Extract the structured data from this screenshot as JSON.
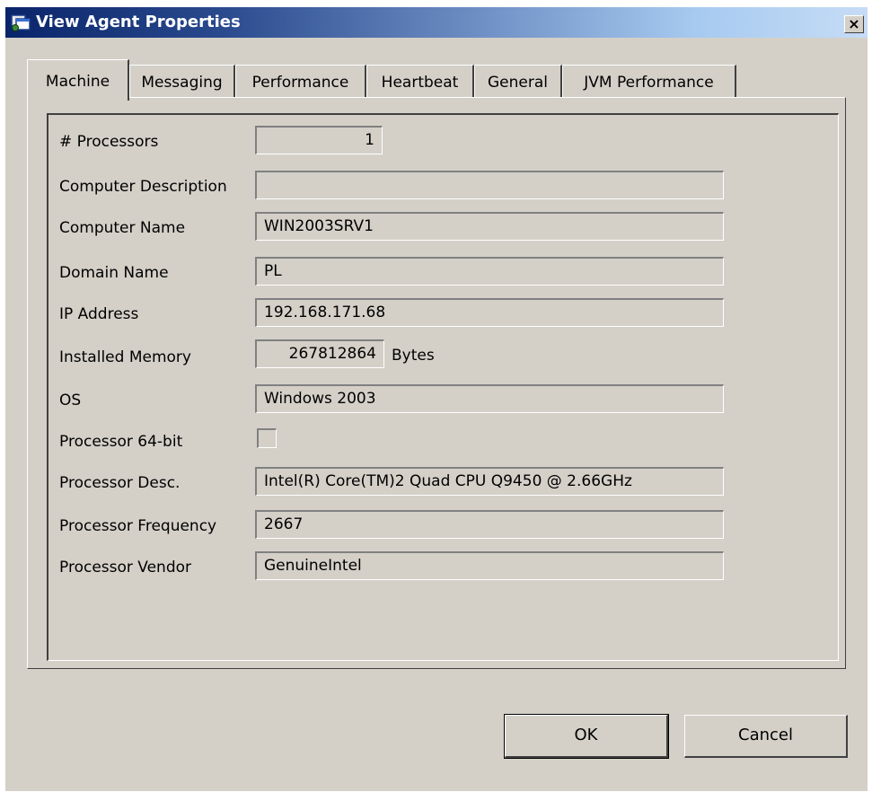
{
  "window": {
    "title": "View Agent Properties",
    "close_label": "×"
  },
  "tabs": [
    {
      "label": "Machine"
    },
    {
      "label": "Messaging"
    },
    {
      "label": "Performance"
    },
    {
      "label": "Heartbeat"
    },
    {
      "label": "General"
    },
    {
      "label": "JVM Performance"
    }
  ],
  "active_tab": "Machine",
  "fields": {
    "processors": {
      "label": "# Processors",
      "value": "1"
    },
    "computer_description": {
      "label": "Computer Description",
      "value": ""
    },
    "computer_name": {
      "label": "Computer Name",
      "value": "WIN2003SRV1"
    },
    "domain_name": {
      "label": "Domain Name",
      "value": "PL"
    },
    "ip_address": {
      "label": "IP Address",
      "value": "192.168.171.68"
    },
    "installed_memory": {
      "label": "Installed Memory",
      "value": "267812864",
      "unit": "Bytes"
    },
    "os": {
      "label": "OS",
      "value": "Windows 2003"
    },
    "processor_64bit": {
      "label": "Processor 64-bit",
      "checked": false
    },
    "processor_desc": {
      "label": "Processor Desc.",
      "value": "Intel(R) Core(TM)2 Quad  CPU   Q9450  @ 2.66GHz"
    },
    "processor_frequency": {
      "label": "Processor Frequency",
      "value": "2667"
    },
    "processor_vendor": {
      "label": "Processor Vendor",
      "value": "GenuineIntel"
    }
  },
  "buttons": {
    "ok": "OK",
    "cancel": "Cancel"
  },
  "icons": {
    "title": "agent-window-icon",
    "close": "close-icon"
  },
  "colors": {
    "titlebar_start": "#0a246a",
    "titlebar_end": "#c6dcf6",
    "dialog_bg": "#d4d0c8"
  }
}
